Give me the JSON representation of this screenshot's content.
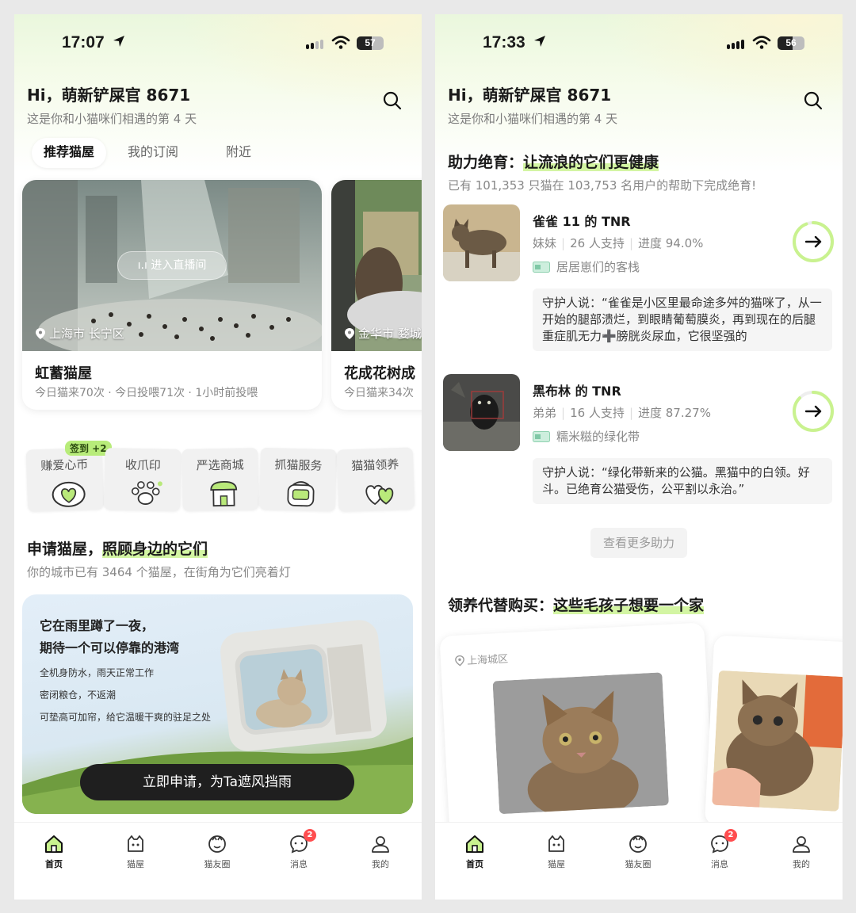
{
  "left_screen": {
    "status": {
      "time": "17:07",
      "battery": "57",
      "battery_level": 0.57
    },
    "greeting": "Hi，萌新铲屎官 8671",
    "greeting_sub": "这是你和小猫咪们相遇的第 4 天",
    "tabs": [
      "推荐猫屋",
      "我的订阅",
      "附近"
    ],
    "live_button": "进入直播间",
    "cards": [
      {
        "location": "上海市 长宁区",
        "title": "虹蓄猫屋",
        "meta": "今日猫来70次 · 今日投喂71次 · 1小时前投喂"
      },
      {
        "location": "金华市 婺城",
        "title": "花成花树成",
        "meta": "今日猫来34次"
      }
    ],
    "sign_badge": "签到 +2",
    "shortcuts": [
      "赚爱心币",
      "收爪印",
      "严选商城",
      "抓猫服务",
      "猫猫领养"
    ],
    "apply_title_a": "申请猫屋，",
    "apply_title_b": "照顾身边的它们",
    "apply_sub": "你的城市已有 3464 个猫屋，在街角为它们亮着灯",
    "banner": {
      "line1": "它在雨里蹲了一夜，",
      "line2": "期待一个可以停靠的港湾",
      "features": [
        "全机身防水，雨天正常工作",
        "密闭粮仓，不返潮",
        "可垫高可加帘，给它温暖干爽的驻足之处"
      ],
      "cta": "立即申请，为Ta遮风挡雨"
    }
  },
  "right_screen": {
    "status": {
      "time": "17:33",
      "battery": "56",
      "battery_level": 0.56
    },
    "greeting": "Hi，萌新铲屎官 8671",
    "greeting_sub": "这是你和小猫咪们相遇的第 4 天",
    "tnr_title_a": "助力绝育：",
    "tnr_title_b": "让流浪的它们更健康",
    "tnr_sub": "已有 101,353 只猫在 103,753 名用户的帮助下完成绝育!",
    "tnr_items": [
      {
        "title": "雀雀 11 的 TNR",
        "gender": "妹妹",
        "supporters": "26 人支持",
        "progress_text": "进度 94.0%",
        "progress": 0.94,
        "place": "居居崽们的客栈",
        "quote": "守护人说：“雀雀是小区里最命途多舛的猫咪了，从一开始的腿部溃烂，到眼睛葡萄膜炎，再到现在的后腿重症肌无力➕膀胱炎尿血，它很坚强的"
      },
      {
        "title": "黑布林 的 TNR",
        "gender": "弟弟",
        "supporters": "16 人支持",
        "progress_text": "进度 87.27%",
        "progress": 0.8727,
        "place": "糯米糍的绿化带",
        "quote": "守护人说：“绿化带新来的公猫。黑猫中的白领。好斗。已绝育公猫受伤，公平割以永治。”"
      }
    ],
    "more_button": "查看更多助力",
    "adopt_title_a": "领养代替购买：",
    "adopt_title_b": "这些毛孩子想要一个家",
    "adopt_location": "上海城区"
  },
  "nav": [
    {
      "label": "首页",
      "icon": "home-icon"
    },
    {
      "label": "猫屋",
      "icon": "cat-house-icon"
    },
    {
      "label": "猫友圈",
      "icon": "cat-circle-icon"
    },
    {
      "label": "消息",
      "icon": "message-icon",
      "badge": "2"
    },
    {
      "label": "我的",
      "icon": "profile-icon"
    }
  ],
  "colors": {
    "accent_green": "#c9f28f",
    "badge_red": "#ff4d4f",
    "cta_dark": "#1f1f1f"
  }
}
